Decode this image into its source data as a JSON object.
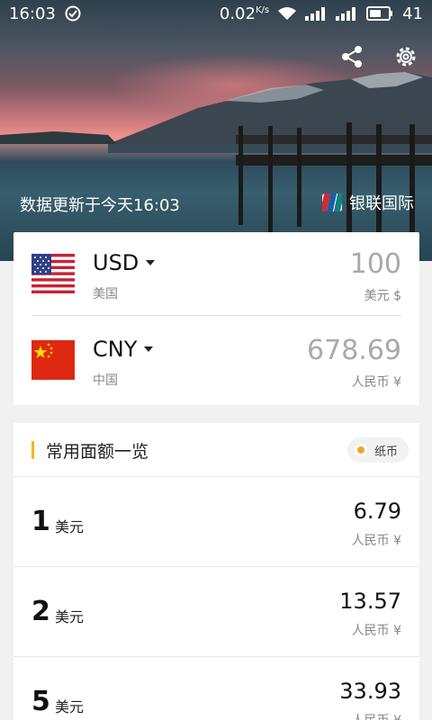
{
  "status_bar": {
    "time": "16:03",
    "net_speed": "0.02",
    "net_unit": "K/s",
    "battery": "41"
  },
  "header": {
    "update_text": "数据更新于今天16:03",
    "source_label": "银联国际",
    "icons": [
      "share-icon",
      "gear-icon"
    ]
  },
  "converter": {
    "from": {
      "code": "USD",
      "country": "美国",
      "amount": "100",
      "unit": "美元 $"
    },
    "to": {
      "code": "CNY",
      "country": "中国",
      "amount": "678.69",
      "unit": "人民币 ¥"
    }
  },
  "denominations": {
    "title": "常用面额一览",
    "chip_label": "纸币",
    "accent_color": "#f5b81f",
    "rows": [
      {
        "num": "1",
        "unit": "美元",
        "value": "6.79",
        "value_unit": "人民币 ¥"
      },
      {
        "num": "2",
        "unit": "美元",
        "value": "13.57",
        "value_unit": "人民币 ¥"
      },
      {
        "num": "5",
        "unit": "美元",
        "value": "33.93",
        "value_unit": "人民币 ¥"
      }
    ]
  }
}
